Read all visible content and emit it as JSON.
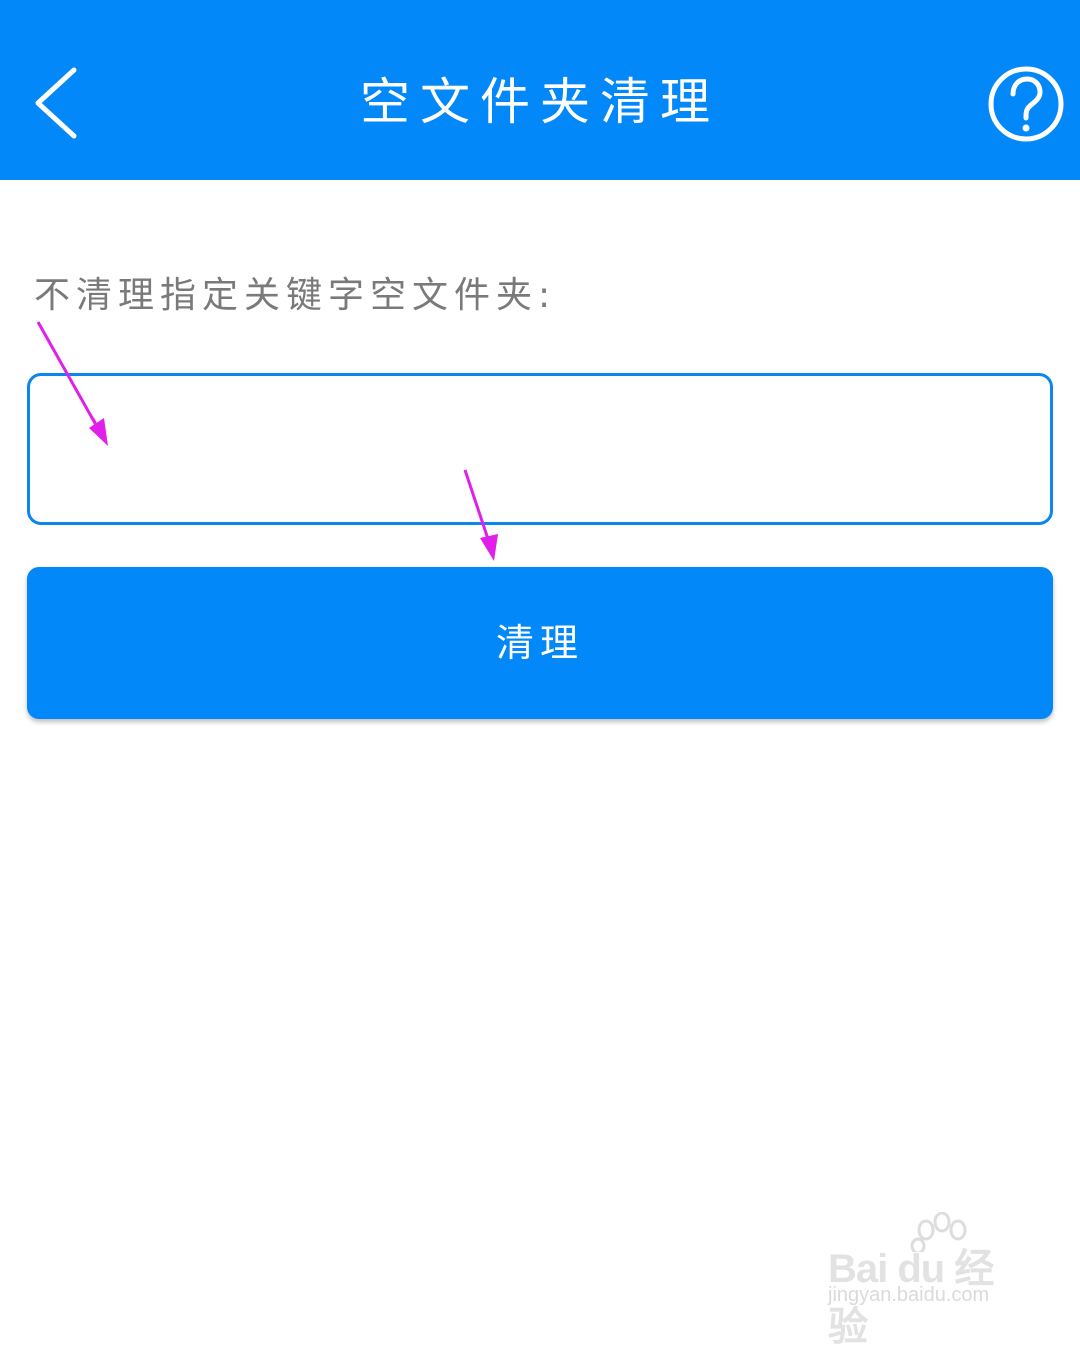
{
  "header": {
    "title": "空文件夹清理",
    "back_icon": "back-chevron-icon",
    "help_icon": "help-question-icon",
    "background_color": "#0288f8"
  },
  "form": {
    "label": "不清理指定关键字空文件夹:",
    "input_value": "",
    "button_label": "清理",
    "accent_color": "#0288f8"
  },
  "annotations": {
    "arrow_icon": "magenta-arrow-icon",
    "color": "#e020e8"
  },
  "watermark": {
    "brand": "Bai du 经验",
    "url": "jingyan.baidu.com"
  }
}
